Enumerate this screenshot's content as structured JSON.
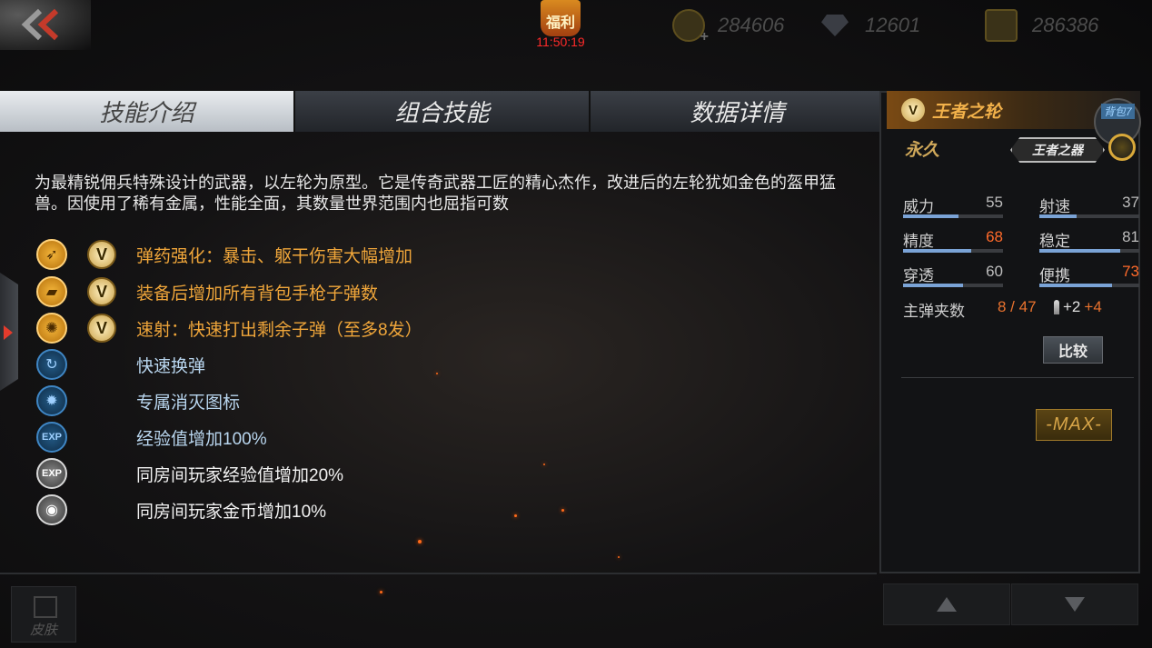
{
  "top_bar": {
    "welfare": {
      "badge_label": "福利",
      "timer": "11:50:19"
    },
    "currencies": [
      {
        "icon": "gold-coin-icon",
        "amount": "284606"
      },
      {
        "icon": "diamond-icon",
        "amount": "12601"
      },
      {
        "icon": "honor-coin-icon",
        "amount": "286386"
      }
    ]
  },
  "tabs": [
    {
      "label": "技能介绍",
      "active": true
    },
    {
      "label": "组合技能",
      "active": false
    },
    {
      "label": "数据详情",
      "active": false
    }
  ],
  "description": "为最精锐佣兵特殊设计的武器，以左轮为原型。它是传奇武器工匠的精心杰作，改进后的左轮犹如金色的盔甲猛兽。因使用了稀有金属，性能全面，其数量世界范围内也屈指可数",
  "skills": [
    {
      "icon": "bullet-upgrade-icon",
      "vip": true,
      "text": "弹药强化：暴击、躯干伤害大幅增加",
      "color": "#f0a63a"
    },
    {
      "icon": "pistol-icon",
      "vip": true,
      "text": "装备后增加所有背包手枪子弹数",
      "color": "#f0a63a"
    },
    {
      "icon": "revolver-cylinder-icon",
      "vip": true,
      "text": "速射：快速打出剩余子弹（至多8发）",
      "color": "#f0a63a"
    },
    {
      "icon": "fast-reload-icon",
      "vip": false,
      "text": "快速换弹",
      "color": "#b9d6ef"
    },
    {
      "icon": "kill-icon",
      "vip": false,
      "text": "专属消灭图标",
      "color": "#b9d6ef"
    },
    {
      "icon": "exp-boost-icon",
      "vip": false,
      "text": "经验值增加100%",
      "color": "#b9d6ef"
    },
    {
      "icon": "room-exp-icon",
      "vip": false,
      "text": "同房间玩家经验值增加20%",
      "color": "#f2f2f2"
    },
    {
      "icon": "room-coin-icon",
      "vip": false,
      "text": "同房间玩家金币增加10%",
      "color": "#f2f2f2"
    }
  ],
  "vip_badge": "V",
  "weapon": {
    "name": "王者之轮",
    "bag_label": "背包7",
    "duration": "永久",
    "series_badge": "王者之器",
    "stats": [
      {
        "label": "威力",
        "value": "55",
        "boosted": false,
        "fill": 0.55
      },
      {
        "label": "射速",
        "value": "37",
        "boosted": false,
        "fill": 0.37
      },
      {
        "label": "精度",
        "value": "68",
        "boosted": true,
        "fill": 0.68
      },
      {
        "label": "稳定",
        "value": "81",
        "boosted": false,
        "fill": 0.81
      },
      {
        "label": "穿透",
        "value": "60",
        "boosted": false,
        "fill": 0.6
      },
      {
        "label": "便携",
        "value": "73",
        "boosted": true,
        "fill": 0.73
      }
    ],
    "ammo_label": "主弹夹数",
    "ammo_value": "8 / 47",
    "ammo_bonus_a": "+2",
    "ammo_bonus_b": "+4",
    "compare_label": "比较",
    "max_label": "-MAX-"
  },
  "bottom": {
    "skin_label": "皮肤"
  },
  "colors": {
    "accent_gold": "#f0a63a",
    "timer_red": "#ff2a2a",
    "boost_orange": "#ff6a2a"
  }
}
